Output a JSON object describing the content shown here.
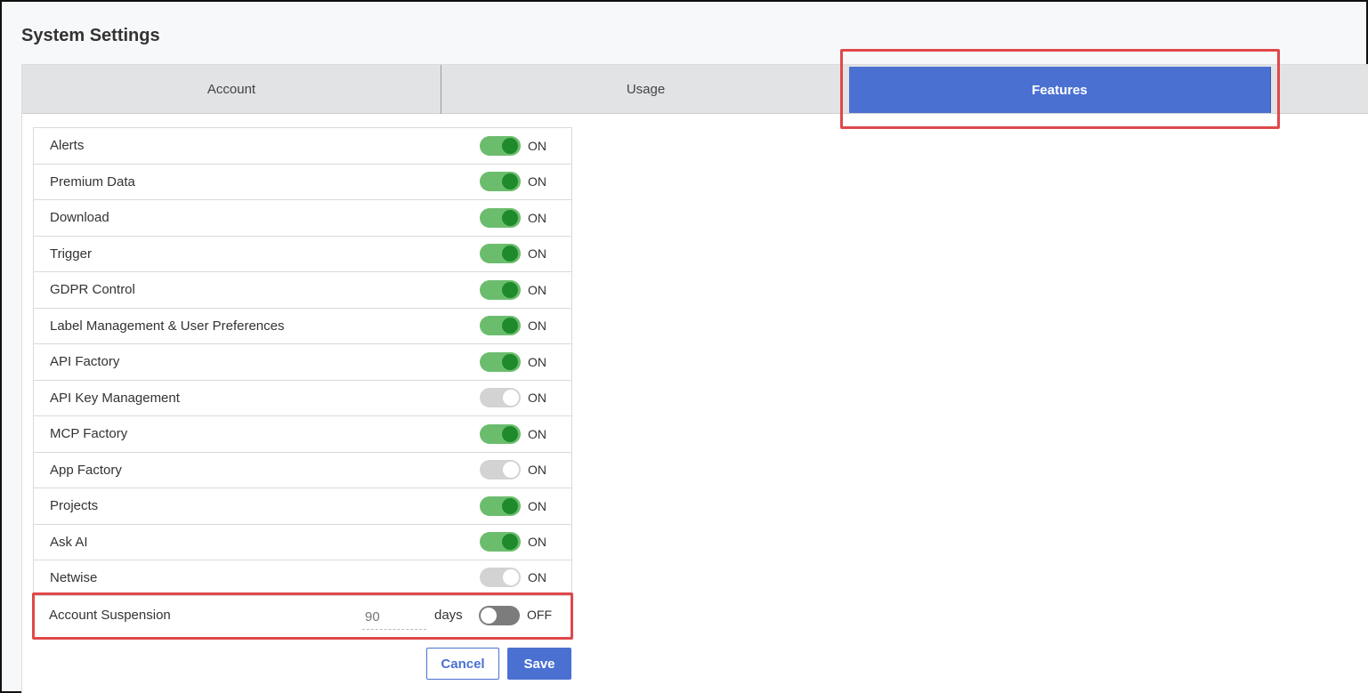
{
  "page": {
    "title": "System Settings"
  },
  "tabs": [
    {
      "label": "Account",
      "active": false
    },
    {
      "label": "Usage",
      "active": false
    },
    {
      "label": "Features",
      "active": true
    }
  ],
  "features": [
    {
      "label": "Alerts",
      "state": "ON",
      "toggle": "on"
    },
    {
      "label": "Premium Data",
      "state": "ON",
      "toggle": "on"
    },
    {
      "label": "Download",
      "state": "ON",
      "toggle": "on"
    },
    {
      "label": "Trigger",
      "state": "ON",
      "toggle": "on"
    },
    {
      "label": "GDPR Control",
      "state": "ON",
      "toggle": "on"
    },
    {
      "label": "Label Management & User Preferences",
      "state": "ON",
      "toggle": "on"
    },
    {
      "label": "API Factory",
      "state": "ON",
      "toggle": "on"
    },
    {
      "label": "API Key Management",
      "state": "ON",
      "toggle": "disabled"
    },
    {
      "label": "MCP Factory",
      "state": "ON",
      "toggle": "on"
    },
    {
      "label": "App Factory",
      "state": "ON",
      "toggle": "disabled"
    },
    {
      "label": "Projects",
      "state": "ON",
      "toggle": "on"
    },
    {
      "label": "Ask AI",
      "state": "ON",
      "toggle": "on"
    },
    {
      "label": "Netwise",
      "state": "ON",
      "toggle": "disabled"
    }
  ],
  "suspension": {
    "label": "Account Suspension",
    "days_placeholder": "90",
    "days_unit": "days",
    "state": "OFF"
  },
  "actions": {
    "cancel": "Cancel",
    "save": "Save"
  },
  "colors": {
    "accent": "#4a70d1",
    "toggle_on": "#6bbd6d",
    "toggle_knob_on": "#1e8a2c",
    "toggle_disabled": "#d3d3d3",
    "toggle_off": "#7c7c7c",
    "highlight": "#e0484a"
  }
}
